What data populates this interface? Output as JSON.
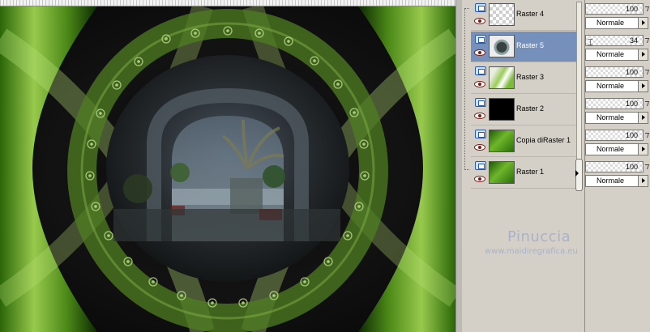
{
  "layers": [
    {
      "name": "Raster 4",
      "thumb": "transparent",
      "selected": false,
      "opacity": "100",
      "blend": "Normale"
    },
    {
      "name": "Raster 5",
      "thumb": "photo",
      "selected": true,
      "opacity": "34",
      "blend": "Normale"
    },
    {
      "name": "Raster 3",
      "thumb": "greenish",
      "selected": false,
      "opacity": "100",
      "blend": "Normale"
    },
    {
      "name": "Raster 2",
      "thumb": "black",
      "selected": false,
      "opacity": "100",
      "blend": "Normale"
    },
    {
      "name": "Copia diRaster 1",
      "thumb": "green",
      "selected": false,
      "opacity": "100",
      "blend": "Normale"
    },
    {
      "name": "Raster 1",
      "thumb": "green",
      "selected": false,
      "opacity": "100",
      "blend": "Normale"
    }
  ],
  "watermark": {
    "title": "Pinuccia",
    "url": "www.maidiregrafica.eu"
  },
  "colors": {
    "selected_row": "#7590ba",
    "panel_bg": "#d4d0c8",
    "art_green_light": "#a7d85a",
    "art_green_dark": "#1c4a06"
  },
  "icons": {
    "layer_type": "raster-layer-icon",
    "visibility": "eye-icon",
    "blend_dropdown": "triangle-right-icon"
  }
}
